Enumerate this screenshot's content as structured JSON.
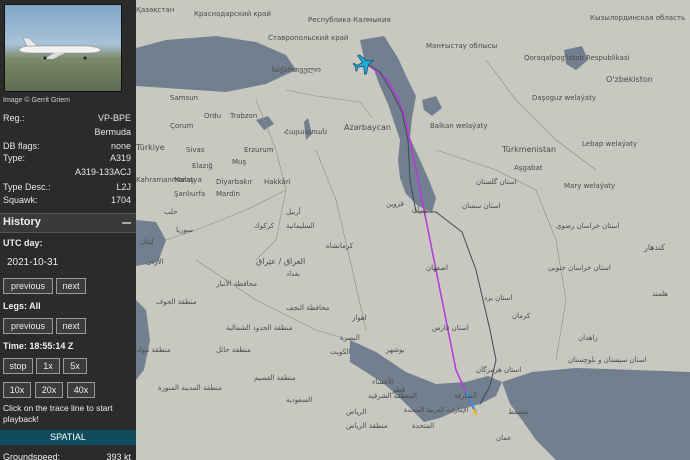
{
  "aircraft": {
    "image_credit": "Image © Gerrit Griem",
    "reg_label": "Reg.:",
    "reg": "VP-BPE",
    "country": "Bermuda",
    "db_flags_label": "DB flags:",
    "db_flags": "none",
    "type_label": "Type:",
    "type": "A319",
    "model": "A319-133ACJ",
    "type_desc_label": "Type Desc.:",
    "type_desc": "L2J",
    "squawk_label": "Squawk:",
    "squawk": "1704"
  },
  "history": {
    "title": "History",
    "utc_day_label": "UTC day:",
    "date": "2021-10-31",
    "previous_label": "previous",
    "next_label": "next",
    "legs_label": "Legs: All",
    "time_label": "Time: 18:55:14 Z",
    "stop_label": "stop",
    "speed_1x": "1x",
    "speed_5x": "5x",
    "speed_10x": "10x",
    "speed_20x": "20x",
    "speed_40x": "40x",
    "help_text": "Click on the trace line to start playback!",
    "spatial_label": "SPATIAL",
    "groundspeed_label": "Groundspeed:",
    "groundspeed_value": "393 kt"
  },
  "map_labels": {
    "kazakhstan": "Қазақстан",
    "krasnodar": "Краснодарский край",
    "kalmykia": "Республика Калмыкия",
    "kyzylorda": "Кызылординская область",
    "stavropol": "Ставропольский край",
    "mangistau": "Манғыстау облысы",
    "qoraqalpogiston": "Qoraqalpog'iston Respublikasi",
    "georgia": "საქართველო",
    "samsun": "Samsun",
    "corum": "Çorum",
    "ordu": "Ordu",
    "trabzon": "Trabzon",
    "azerbaijan": "Azərbaycan",
    "armenia": "Հայաստան",
    "balkan": "Balkan welaýaty",
    "turkmenistan": "Türkmenistan",
    "uzbekistan": "O'zbekiston",
    "dashoguz": "Daşoguz welaýaty",
    "lebap": "Lebap welaýaty",
    "ashgabat": "Aşgabat",
    "mary": "Mary welaýaty",
    "turkiye": "Türkiye",
    "sivas": "Sivas",
    "erzurum": "Erzurum",
    "elazig": "Elazığ",
    "mus": "Muş",
    "malatya": "Malatya",
    "kahramanmaras": "Kahramanmaraş",
    "diyarbakir": "Diyarbakır",
    "hakkari": "Hakkâri",
    "sanliurfa": "Şanlıurfa",
    "mardin": "Mardin",
    "syria": "سوريا",
    "aleppo": "حلب",
    "iraq": "العراق / عێراق",
    "lebanon": "لبنان",
    "erbil": "أربيل",
    "sulaymaniyah": "السليمانية",
    "kirkuk": "كركوك",
    "tehran": "تهران",
    "qazvin": "قزوین",
    "isfahan": "اصفهان",
    "kermanshah": "کرمانشاه",
    "semnan": "استان سمنان",
    "khorasan": "استان خراسان رضوی",
    "south_khorasan": "استان خراسان جنوبی",
    "golestan": "استان گلستان",
    "yazd": "استان یزد",
    "kerman": "کرمان",
    "zahedan": "زاهدان",
    "sistan": "استان سیستان و بلوچستان",
    "kandahar": "کندهار",
    "helmand": "هلمند",
    "fars": "استان فارس",
    "bushehr": "بوشهر",
    "hormozgan": "استان هرمزگان",
    "ahvaz": "اهواز",
    "basra": "البصرة",
    "kuwait": "الكويت",
    "baghdad": "بغداد",
    "anbar": "محافظة الأنبار",
    "najaf": "محافظة النجف",
    "hail": "منطقة حائل",
    "jawf": "منطقة الجوف",
    "tabuk": "منطقة تبوك",
    "medina": "منطقة المدينة المنورة",
    "qassim": "منطقة القصيم",
    "riyadh": "الرياض",
    "riyadh_region": "منطقة الرياض",
    "eastern": "المنطقة الشرقية",
    "saudi": "السعودية",
    "ahsa": "الأحساء",
    "uae": "الإمارات العربية المتحدة",
    "qatar": "قطر",
    "muscat": "مسقط",
    "oman": "عمان",
    "northern_borders": "منطقة الحدود الشمالية",
    "jordan": "الأردن",
    "sharjah": "الشارقة",
    "united": "المتحدة"
  }
}
